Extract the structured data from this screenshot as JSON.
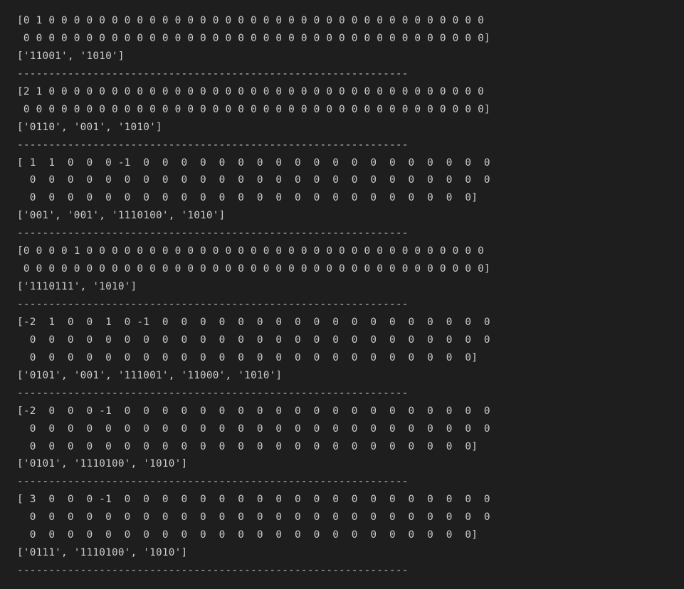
{
  "terminal": {
    "lines": [
      "[0 1 0 0 0 0 0 0 0 0 0 0 0 0 0 0 0 0 0 0 0 0 0 0 0 0 0 0 0 0 0 0 0 0 0 0 0",
      " 0 0 0 0 0 0 0 0 0 0 0 0 0 0 0 0 0 0 0 0 0 0 0 0 0 0 0 0 0 0 0 0 0 0 0 0 0]",
      "['11001', '1010']",
      "--------------------------------------------------------------",
      "[2 1 0 0 0 0 0 0 0 0 0 0 0 0 0 0 0 0 0 0 0 0 0 0 0 0 0 0 0 0 0 0 0 0 0 0 0",
      " 0 0 0 0 0 0 0 0 0 0 0 0 0 0 0 0 0 0 0 0 0 0 0 0 0 0 0 0 0 0 0 0 0 0 0 0 0]",
      "['0110', '001', '1010']",
      "--------------------------------------------------------------",
      "[ 1  1  0  0  0 -1  0  0  0  0  0  0  0  0  0  0  0  0  0  0  0  0  0  0  0",
      "  0  0  0  0  0  0  0  0  0  0  0  0  0  0  0  0  0  0  0  0  0  0  0  0  0",
      "  0  0  0  0  0  0  0  0  0  0  0  0  0  0  0  0  0  0  0  0  0  0  0  0]",
      "['001', '001', '1110100', '1010']",
      "--------------------------------------------------------------",
      "[0 0 0 0 1 0 0 0 0 0 0 0 0 0 0 0 0 0 0 0 0 0 0 0 0 0 0 0 0 0 0 0 0 0 0 0 0",
      " 0 0 0 0 0 0 0 0 0 0 0 0 0 0 0 0 0 0 0 0 0 0 0 0 0 0 0 0 0 0 0 0 0 0 0 0 0]",
      "['1110111', '1010']",
      "--------------------------------------------------------------",
      "[-2  1  0  0  1  0 -1  0  0  0  0  0  0  0  0  0  0  0  0  0  0  0  0  0  0",
      "  0  0  0  0  0  0  0  0  0  0  0  0  0  0  0  0  0  0  0  0  0  0  0  0  0",
      "  0  0  0  0  0  0  0  0  0  0  0  0  0  0  0  0  0  0  0  0  0  0  0  0]",
      "['0101', '001', '111001', '11000', '1010']",
      "--------------------------------------------------------------",
      "[-2  0  0  0 -1  0  0  0  0  0  0  0  0  0  0  0  0  0  0  0  0  0  0  0  0",
      "  0  0  0  0  0  0  0  0  0  0  0  0  0  0  0  0  0  0  0  0  0  0  0  0  0",
      "  0  0  0  0  0  0  0  0  0  0  0  0  0  0  0  0  0  0  0  0  0  0  0  0]",
      "['0101', '1110100', '1010']",
      "--------------------------------------------------------------",
      "[ 3  0  0  0 -1  0  0  0  0  0  0  0  0  0  0  0  0  0  0  0  0  0  0  0  0",
      "  0  0  0  0  0  0  0  0  0  0  0  0  0  0  0  0  0  0  0  0  0  0  0  0  0",
      "  0  0  0  0  0  0  0  0  0  0  0  0  0  0  0  0  0  0  0  0  0  0  0  0]",
      "['0111', '1110100', '1010']",
      "--------------------------------------------------------------"
    ]
  }
}
